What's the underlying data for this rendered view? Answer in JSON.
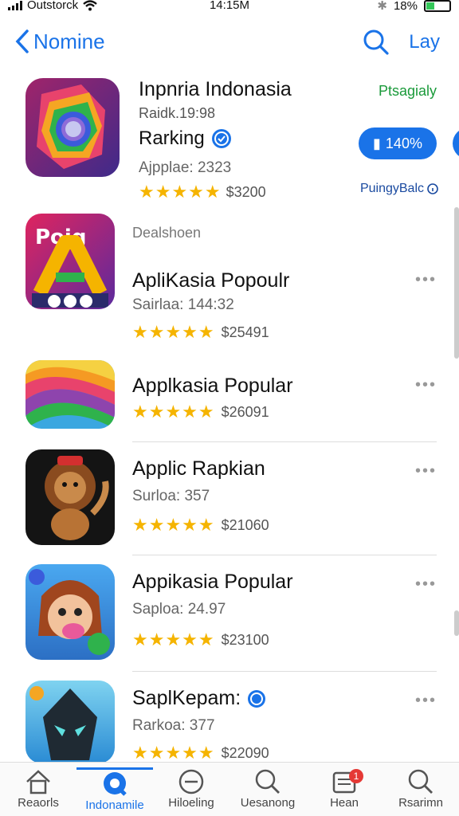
{
  "status": {
    "carrier": "Outstorck",
    "time": "14:15M",
    "battery": "18%"
  },
  "nav": {
    "back_label": "Nomine",
    "right_label": "Lay"
  },
  "featured": {
    "title": "Inpnria Indonasia",
    "sub1": "Raidk.19:98",
    "ranking_label": "Rarking",
    "sub2": "Ajpplae: 2323",
    "rating_stars": 5,
    "price": "$3200",
    "tag": "Ptsagialy",
    "button_label": "140%",
    "more_label": "PuingyBalc"
  },
  "section_label": "Dealshoen",
  "apps": [
    {
      "name": "ApliKasia Popoulr",
      "meta": "Sairlaa: 144:32",
      "rating_stars": 5,
      "price": "$25491",
      "icon": "alpha-a-icon"
    },
    {
      "name": "Applkasia Popular",
      "meta": "",
      "rating_stars": 5,
      "price": "$26091",
      "icon": "rainbow-wave-icon"
    },
    {
      "name": "Applic Rapkian",
      "meta": "Surloa: 357",
      "rating_stars": 5,
      "price": "$21060",
      "icon": "lion-icon"
    },
    {
      "name": "Appikasia Popular",
      "meta": "Saploa: 24.97",
      "rating_stars": 5,
      "price": "$23100",
      "icon": "cartoon-character-icon"
    },
    {
      "name": "SaplKepam:",
      "meta": "Rarkoa: 377",
      "rating_stars": 5,
      "price": "$22090",
      "icon": "robot-icon"
    }
  ],
  "tabs": [
    {
      "label": "Reaorls",
      "icon": "home-icon"
    },
    {
      "label": "Indonamile",
      "icon": "store-icon",
      "active": true
    },
    {
      "label": "Hiloeling",
      "icon": "minus-circle-icon"
    },
    {
      "label": "Uesanong",
      "icon": "search-icon"
    },
    {
      "label": "Hean",
      "icon": "updates-icon",
      "badge": "1"
    },
    {
      "label": "Rsarimn",
      "icon": "search-icon"
    }
  ],
  "colors": {
    "accent": "#1a73e8",
    "stars": "#f5b400",
    "green": "#1a9a3a"
  }
}
